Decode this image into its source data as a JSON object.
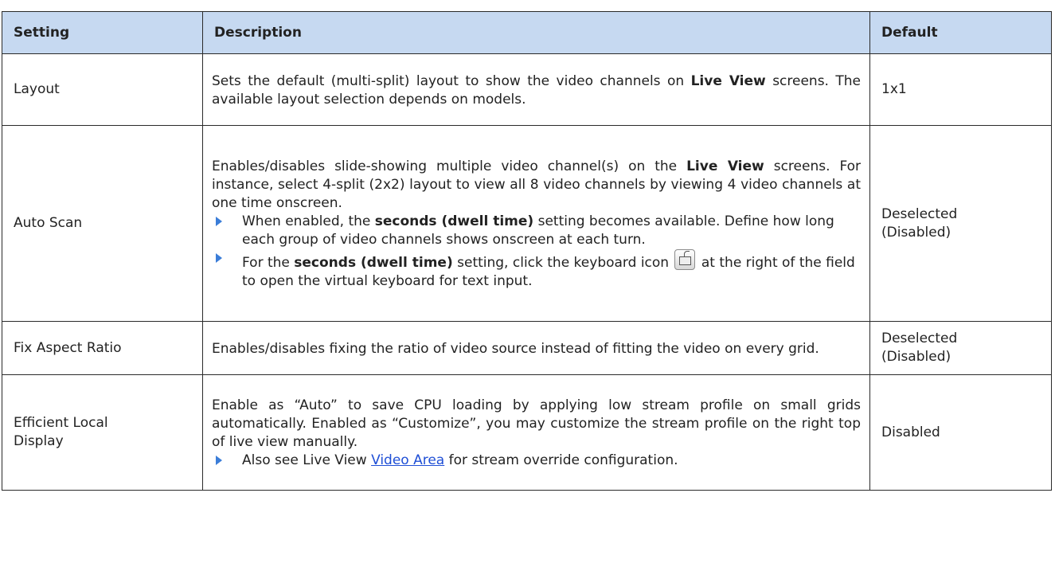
{
  "header": {
    "setting": "Setting",
    "description": "Description",
    "default": "Default"
  },
  "rows": [
    {
      "setting": "Layout",
      "desc_lines": [
        "Sets the default (multi-split) layout to show the video channels on",
        "screens. The available layout selection depends on",
        "models."
      ],
      "desc_bold": "Live View",
      "default": "1x1"
    },
    {
      "setting": "Auto Scan",
      "desc_pre": "Enables/disables slide-showing multiple video channel(s) on the",
      "desc_bold": "Live View",
      "desc_mid": "screens. For instance, select 4-split (2x2) layout to view all 8 video channels by viewing 4 video channels at one time onscreen.",
      "bullets": [
        {
          "pre": "When enabled, the",
          "bold": "seconds (dwell time)",
          "post": "setting becomes available. Define how long each group of video channels shows onscreen at each turn."
        },
        {
          "pre": "For the",
          "bold": "seconds (dwell time)",
          "post": "setting, click the keyboard",
          "post2": "icon",
          "icon": "keyboard-icon",
          "post3": "at the right of the field to open the virtual keyboard for text input."
        }
      ],
      "default_lines": [
        "Deselected",
        "(Disabled)"
      ]
    },
    {
      "setting": "Fix Aspect Ratio",
      "desc": "Enables/disables fixing the ratio of video source instead of fitting the video on every grid.",
      "default_lines": [
        "Deselected",
        "(Disabled)"
      ]
    },
    {
      "setting_lines": [
        "Efficient Local",
        "Display"
      ],
      "desc": "Enable as “Auto” to save CPU loading by applying low stream profile on small grids automatically. Enabled as “Customize”, you may customize the stream profile on the right top of live view manually.",
      "bullet": {
        "pre": "Also see Live View",
        "link": "Video Area",
        "post": "for stream override configuration."
      },
      "default": "Disabled"
    }
  ],
  "colors": {
    "header_bg": "#c6d9f1",
    "bullet": "#3b7dd8",
    "link": "#1f4fd6"
  }
}
